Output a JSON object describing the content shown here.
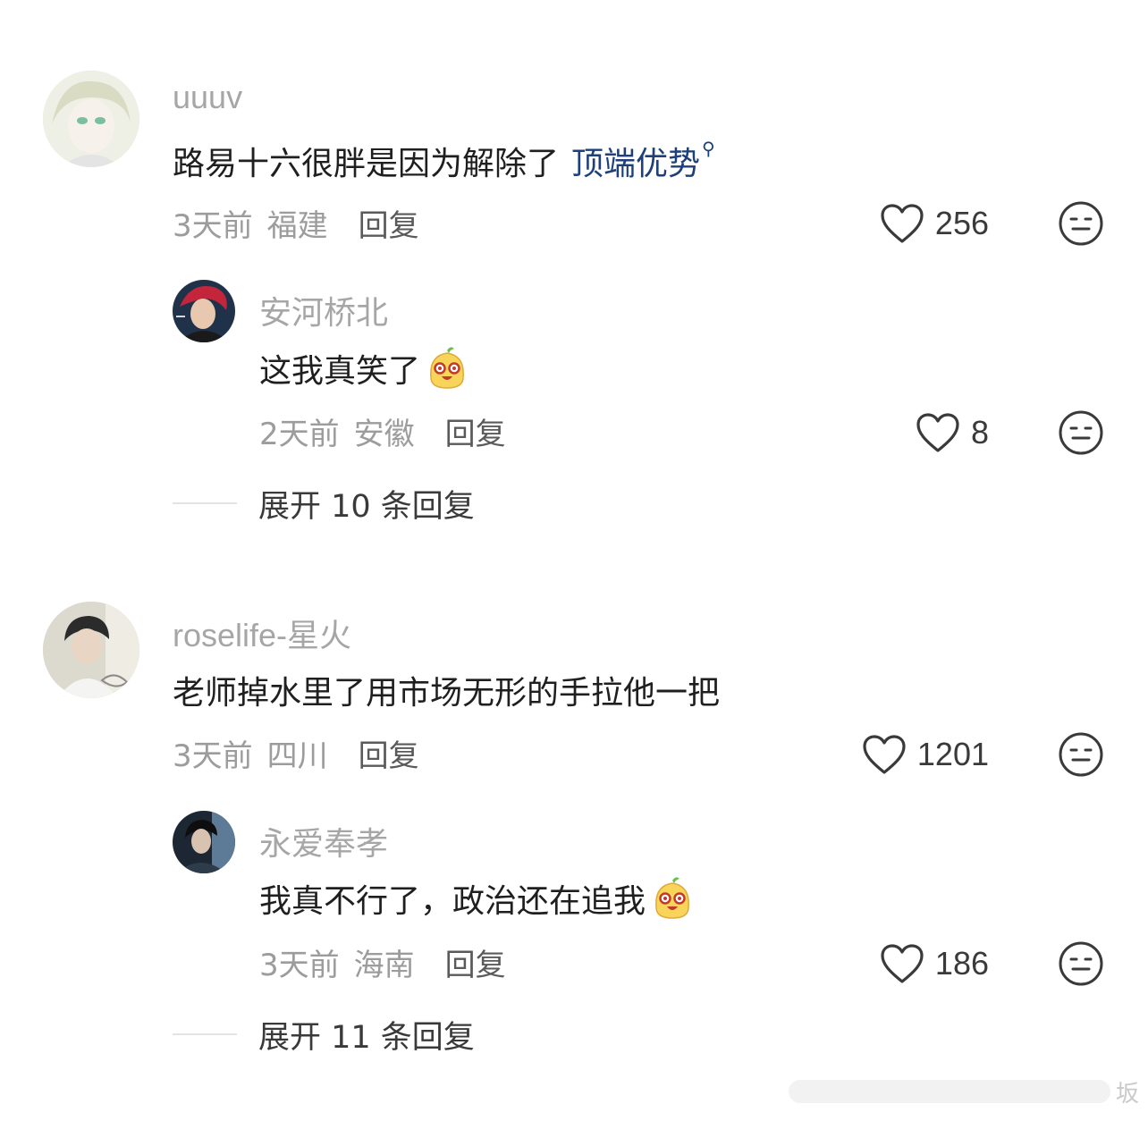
{
  "comments": [
    {
      "user": "uuuv",
      "text": "路易十六很胖是因为解除了",
      "link": "顶端优势",
      "link_icon": "search-icon",
      "time": "3天前",
      "location": "福建",
      "reply_label": "回复",
      "likes": "256",
      "reply": {
        "user": "安河桥北",
        "text": "这我真笑了",
        "emoji": "laughing-bun-emoji",
        "time": "2天前",
        "location": "安徽",
        "reply_label": "回复",
        "likes": "8"
      },
      "expand": "展开 10 条回复"
    },
    {
      "user": "roselife-星火",
      "text": "老师掉水里了用市场无形的手拉他一把",
      "time": "3天前",
      "location": "四川",
      "reply_label": "回复",
      "likes": "1201",
      "reply": {
        "user": "永爱奉孝",
        "text": "我真不行了，政治还在追我",
        "emoji": "laughing-bun-emoji",
        "time": "3天前",
        "location": "海南",
        "reply_label": "回复",
        "likes": "186"
      },
      "expand": "展开 11 条回复"
    }
  ],
  "watermark": {
    "char": "坂"
  },
  "colors": {
    "link": "#1d3f7a",
    "username": "#a6a6a6",
    "meta": "#9c9c9c"
  }
}
